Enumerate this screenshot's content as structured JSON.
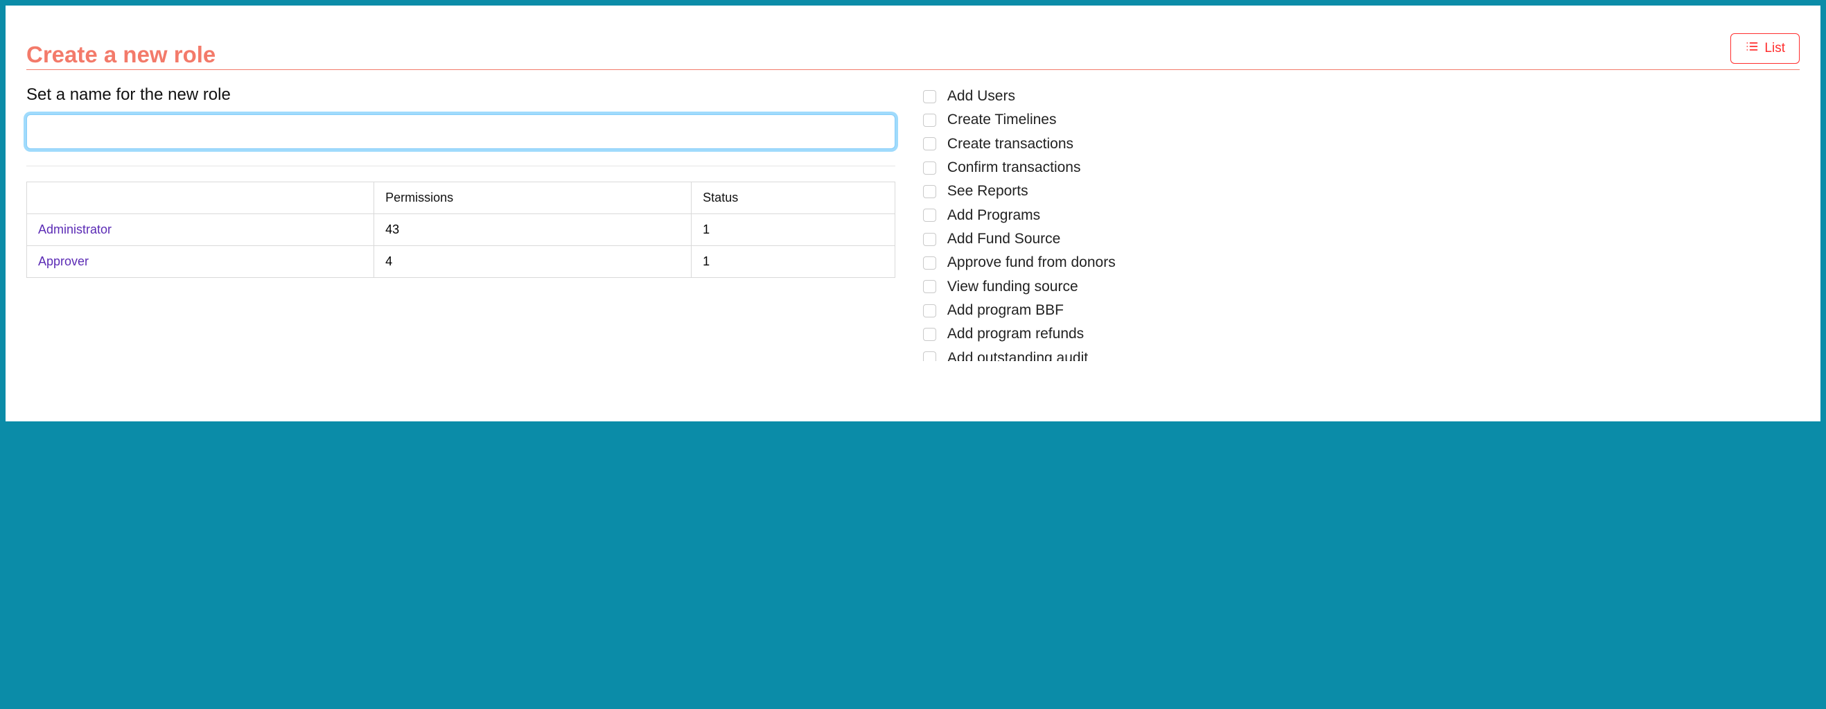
{
  "header": {
    "title": "Create a new role",
    "list_button_label": "List"
  },
  "form": {
    "name_label": "Set a name for the new role",
    "name_value": ""
  },
  "roles_table": {
    "columns": [
      "",
      "Permissions",
      "Status"
    ],
    "rows": [
      {
        "name": "Administrator",
        "permissions": "43",
        "status": "1"
      },
      {
        "name": "Approver",
        "permissions": "4",
        "status": "1"
      }
    ]
  },
  "permissions": [
    "Add Users",
    "Create Timelines",
    "Create transactions",
    "Confirm transactions",
    "See Reports",
    "Add Programs",
    "Add Fund Source",
    "Approve fund from donors",
    "View funding source",
    "Add program BBF",
    "Add program refunds",
    "Add outstanding audit"
  ]
}
